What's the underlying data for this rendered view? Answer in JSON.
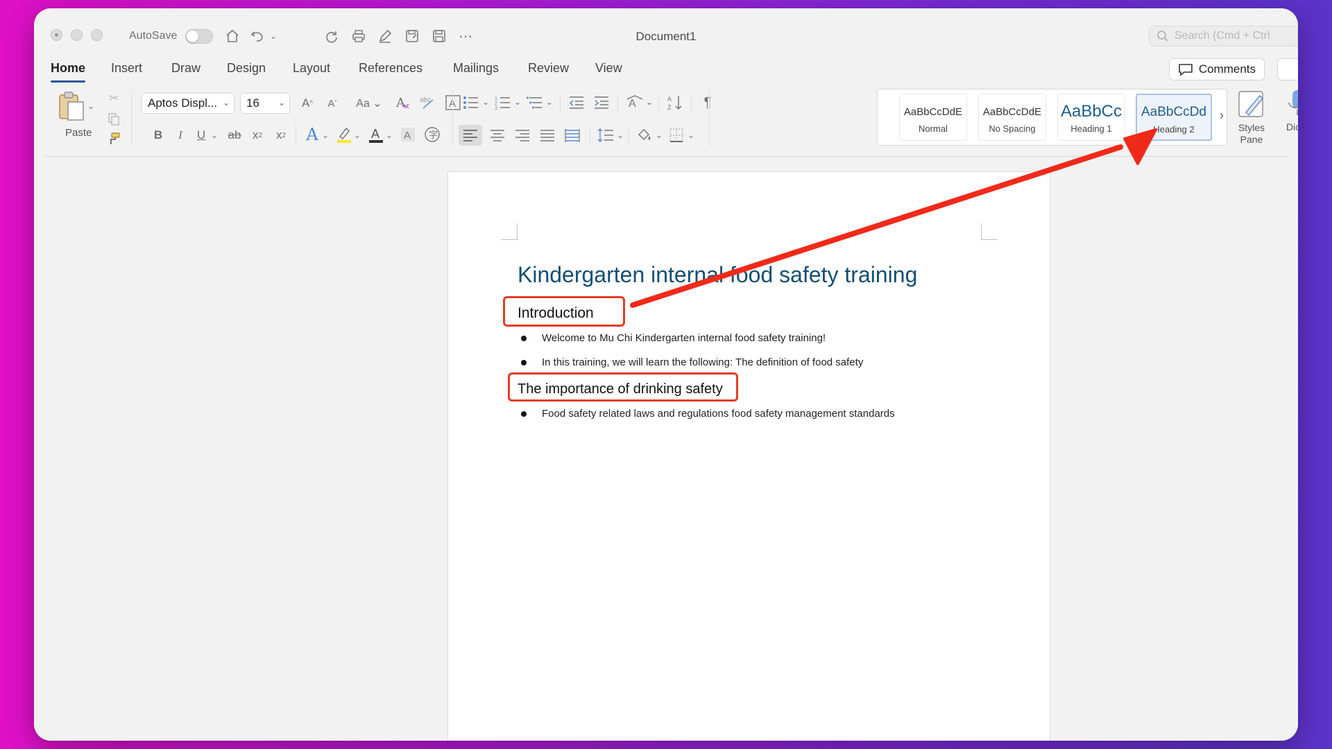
{
  "window": {
    "title": "Document1",
    "autosave_label": "AutoSave",
    "search_placeholder": "Search (Cmd + Ctrl",
    "comments_label": "Comments"
  },
  "tabs": [
    {
      "label": "Home",
      "active": true
    },
    {
      "label": "Insert"
    },
    {
      "label": "Draw"
    },
    {
      "label": "Design"
    },
    {
      "label": "Layout"
    },
    {
      "label": "References"
    },
    {
      "label": "Mailings"
    },
    {
      "label": "Review"
    },
    {
      "label": "View"
    }
  ],
  "ribbon": {
    "paste_label": "Paste",
    "font_name": "Aptos Displ...",
    "font_size": "16",
    "styles": [
      {
        "sample": "AaBbCcDdE",
        "name": "Normal"
      },
      {
        "sample": "AaBbCcDdE",
        "name": "No Spacing"
      },
      {
        "sample": "AaBbCc",
        "name": "Heading 1"
      },
      {
        "sample": "AaBbCcDd",
        "name": "Heading 2",
        "selected": true
      }
    ],
    "styles_pane_label": "Styles Pane",
    "dictate_label": "Dictate"
  },
  "document": {
    "title": "Kindergarten internal food safety training",
    "heading_intro": "Introduction",
    "bullets_intro": [
      "Welcome to Mu Chi Kindergarten internal food safety training!",
      "In this training, we will learn the following: The definition of food safety"
    ],
    "heading_importance": "The importance of drinking safety",
    "bullets_importance": [
      "Food safety related laws and regulations food safety management standards"
    ]
  },
  "colors": {
    "annotation_red": "#e53b25",
    "title_blue": "#124f74",
    "active_tab_underline": "#2b579a"
  }
}
